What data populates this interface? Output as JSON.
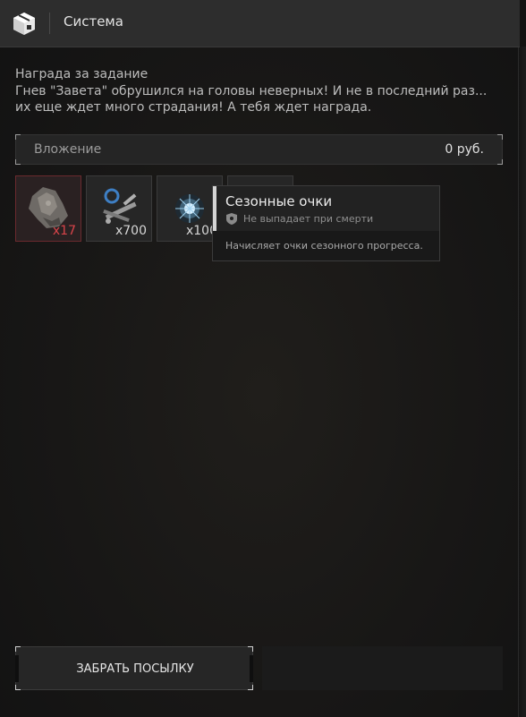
{
  "window": {
    "title": "Система",
    "icon": "parcel-box-icon"
  },
  "quest": {
    "title": "Награда за задание",
    "description_line1": "Гнев \"Завета\" обрушился на головы неверных! И не в последний раз...",
    "description_line2": "их еще ждет много страдания! А тебя ждет награда."
  },
  "attachment": {
    "label": "Вложение",
    "value": "0  руб."
  },
  "items": [
    {
      "icon": "ore-chunk-icon",
      "qty": "x17",
      "highlight": "red"
    },
    {
      "icon": "weapon-parts-icon",
      "qty": "x700"
    },
    {
      "icon": "energy-orb-icon",
      "qty": "x100"
    },
    {
      "icon": "empty-slot",
      "qty": ""
    }
  ],
  "tooltip": {
    "title": "Сезонные очки",
    "tag": "Не выпадает при смерти",
    "description": "Начисляет очки сезонного прогресса."
  },
  "actions": {
    "claim_label": "ЗАБРАТЬ ПОСЫЛКУ"
  },
  "colors": {
    "accent_red": "#d9444a",
    "text": "#bdbdbd",
    "panel": "#262626"
  }
}
